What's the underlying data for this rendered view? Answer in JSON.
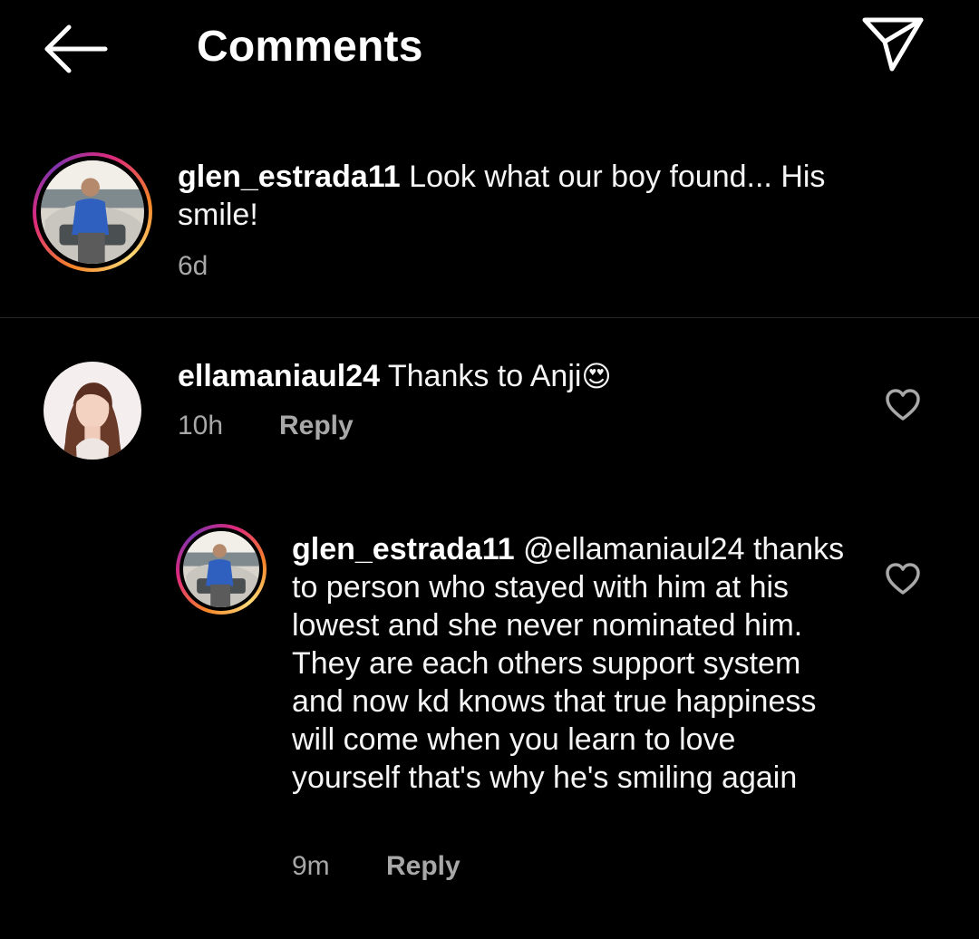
{
  "header": {
    "title": "Comments",
    "back_icon": "arrow-left-icon",
    "share_icon": "paper-plane-icon"
  },
  "caption": {
    "username": "glen_estrada11",
    "text": "Look what our boy found... His smile!",
    "time": "6d"
  },
  "comments": [
    {
      "username": "ellamaniaul24",
      "text": "Thanks to Anji",
      "emoji": "😍",
      "time": "10h",
      "reply_label": "Reply"
    }
  ],
  "replies": [
    {
      "username": "glen_estrada11",
      "mention": "@ellamaniaul24",
      "text": "thanks to person who stayed with him at his lowest and she never nominated him. They are each others support system and now  kd knows that true happiness will come when you learn to love yourself that's why he's smiling again",
      "time": "9m",
      "reply_label": "Reply"
    }
  ],
  "colors": {
    "background": "#000000",
    "text": "#ffffff",
    "meta": "#a8a8a8",
    "divider": "#262626",
    "story_ring": [
      "#f58529",
      "#dd2a7b",
      "#8134af"
    ]
  }
}
